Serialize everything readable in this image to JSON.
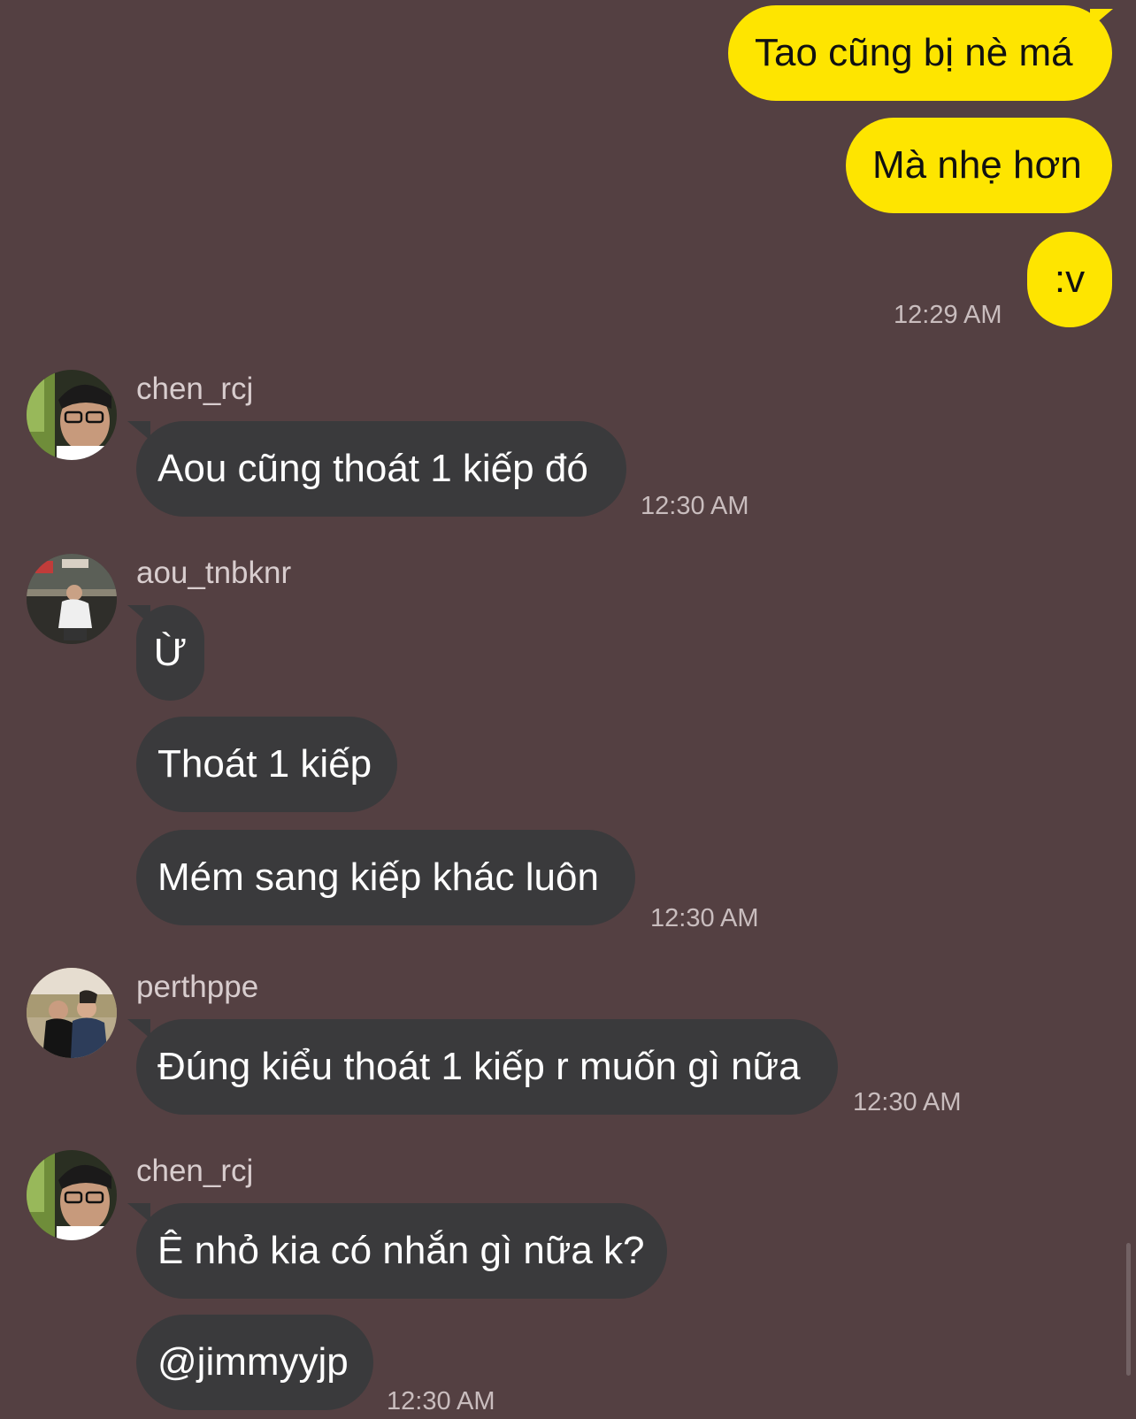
{
  "messages": {
    "outgoing": {
      "m1": "Tao cũng bị nè má",
      "m2": "Mà nhẹ hơn",
      "m3": ":v",
      "time": "12:29 AM"
    },
    "group1": {
      "sender": "chen_rcj",
      "m1": "Aou cũng thoát 1 kiếp đó",
      "time": "12:30 AM"
    },
    "group2": {
      "sender": "aou_tnbknr",
      "m1": "Ừ",
      "m2": "Thoát 1 kiếp",
      "m3": "Mém sang kiếp khác luôn",
      "time": "12:30 AM"
    },
    "group3": {
      "sender": "perthppe",
      "m1": "Đúng kiểu thoát 1 kiếp r muốn gì nữa",
      "time": "12:30 AM"
    },
    "group4": {
      "sender": "chen_rcj",
      "m1": "Ê nhỏ kia có nhắn gì nữa k?",
      "m2": "@jimmyyjp",
      "time": "12:30 AM"
    }
  },
  "colors": {
    "background": "#544042",
    "outgoing_bubble": "#FEE500",
    "incoming_bubble": "#3A3A3C"
  }
}
